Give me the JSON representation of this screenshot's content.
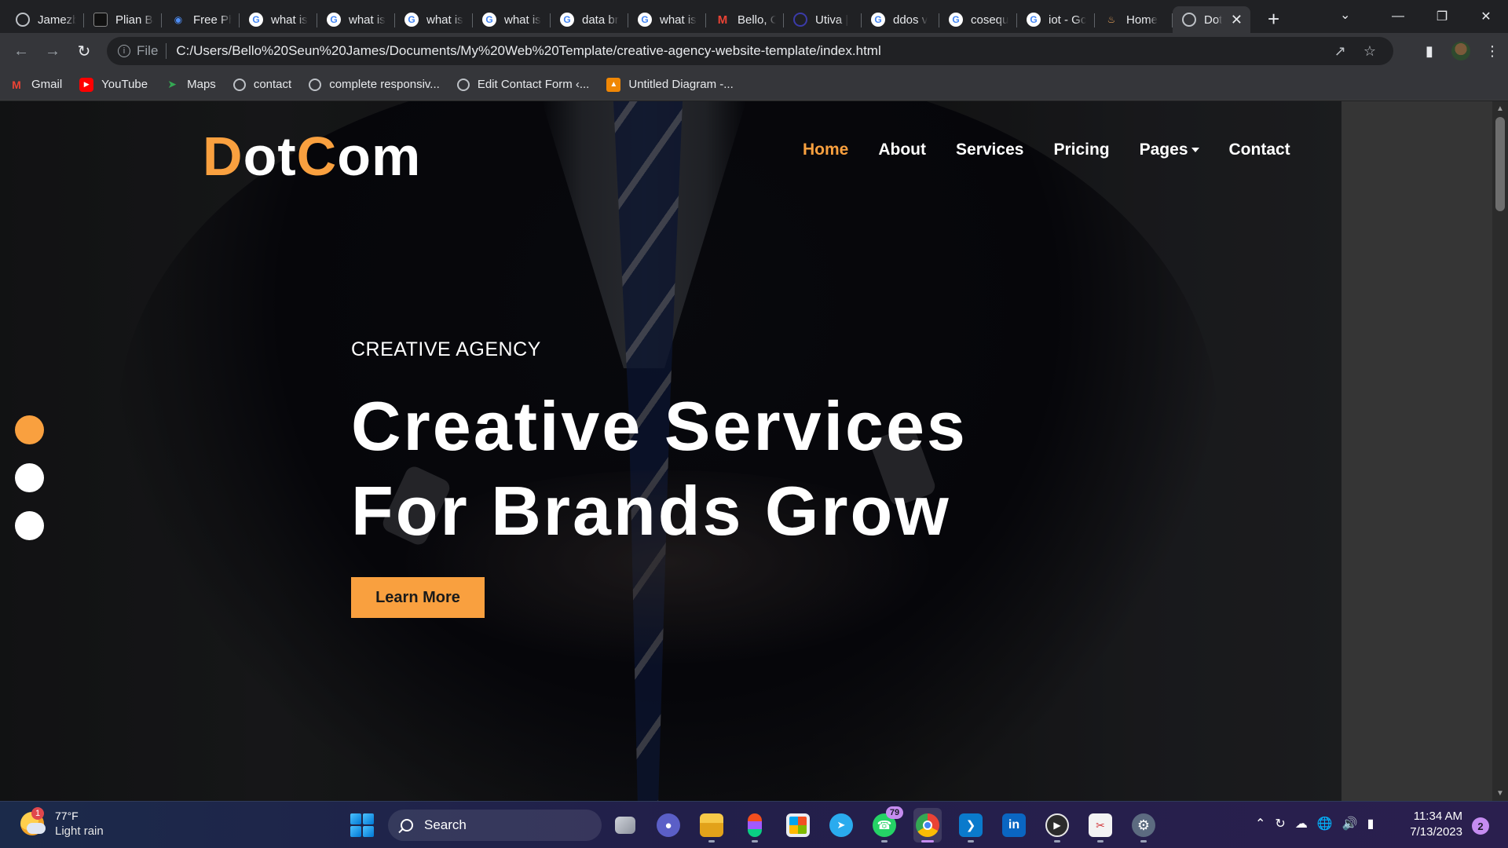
{
  "browser": {
    "tabs": [
      {
        "title": "Jamezb",
        "favicon": "globe-icon",
        "active": false
      },
      {
        "title": "Plian Ba",
        "favicon": "plian-icon",
        "active": false
      },
      {
        "title": "Free Ph",
        "favicon": "freepik-icon",
        "active": false
      },
      {
        "title": "what is",
        "favicon": "google-icon",
        "active": false
      },
      {
        "title": "what is",
        "favicon": "google-icon",
        "active": false
      },
      {
        "title": "what is",
        "favicon": "google-icon",
        "active": false
      },
      {
        "title": "what is",
        "favicon": "google-icon",
        "active": false
      },
      {
        "title": "data br",
        "favicon": "google-icon",
        "active": false
      },
      {
        "title": "what is",
        "favicon": "google-icon",
        "active": false
      },
      {
        "title": "Bello, C",
        "favicon": "gmail-icon",
        "active": false
      },
      {
        "title": "Utiva |",
        "favicon": "utiva-icon",
        "active": false
      },
      {
        "title": "ddos v",
        "favicon": "google-icon",
        "active": false
      },
      {
        "title": "cosequ",
        "favicon": "google-icon",
        "active": false
      },
      {
        "title": "iot - Gc",
        "favicon": "google-icon",
        "active": false
      },
      {
        "title": "Home",
        "favicon": "home-icon",
        "active": false
      },
      {
        "title": "Dot",
        "favicon": "globe-icon",
        "active": true
      }
    ],
    "new_tab_glyph": "+",
    "address": {
      "scheme_label": "File",
      "url": "C:/Users/Bello%20Seun%20James/Documents/My%20Web%20Template/creative-agency-website-template/index.html"
    },
    "bookmarks": [
      {
        "label": "Gmail",
        "icon": "gmail-icon"
      },
      {
        "label": "YouTube",
        "icon": "youtube-icon"
      },
      {
        "label": "Maps",
        "icon": "maps-icon"
      },
      {
        "label": "contact",
        "icon": "globe-icon"
      },
      {
        "label": "complete responsiv...",
        "icon": "globe-icon"
      },
      {
        "label": "Edit Contact Form ‹...",
        "icon": "wordpress-icon"
      },
      {
        "label": "Untitled Diagram -...",
        "icon": "drawio-icon"
      }
    ]
  },
  "page": {
    "brand": {
      "first_letter": "D",
      "part1": "ot",
      "accent_letter": "C",
      "part2": "om"
    },
    "nav": [
      {
        "label": "Home",
        "active": true
      },
      {
        "label": "About",
        "active": false
      },
      {
        "label": "Services",
        "active": false
      },
      {
        "label": "Pricing",
        "active": false
      },
      {
        "label": "Pages",
        "active": false,
        "dropdown": true
      },
      {
        "label": "Contact",
        "active": false
      }
    ],
    "hero": {
      "eyebrow": "CREATIVE AGENCY",
      "headline_line1": "Creative Services",
      "headline_line2": "For Brands Grow",
      "cta_label": "Learn More"
    },
    "carousel": {
      "slides": 3,
      "current_slide": 1
    },
    "colors": {
      "accent": "#f9a03f",
      "text": "#ffffff"
    }
  },
  "taskbar": {
    "weather": {
      "temp": "77°F",
      "desc": "Light rain",
      "badge": "1"
    },
    "search_label": "Search",
    "apps": [
      {
        "name": "task-view",
        "active": false
      },
      {
        "name": "teams",
        "active": false
      },
      {
        "name": "file-explorer",
        "active": false
      },
      {
        "name": "figma",
        "active": false
      },
      {
        "name": "microsoft-store",
        "active": false
      },
      {
        "name": "telegram",
        "active": false
      },
      {
        "name": "whatsapp",
        "active": false,
        "badge": "79"
      },
      {
        "name": "chrome",
        "active": true
      },
      {
        "name": "vscode",
        "active": false
      },
      {
        "name": "linkedin",
        "active": false
      },
      {
        "name": "media-player",
        "active": false
      },
      {
        "name": "snipping-tool",
        "active": false
      },
      {
        "name": "settings",
        "active": false
      }
    ],
    "clock": {
      "time": "11:34 AM",
      "date": "7/13/2023"
    },
    "notifications": "2"
  }
}
